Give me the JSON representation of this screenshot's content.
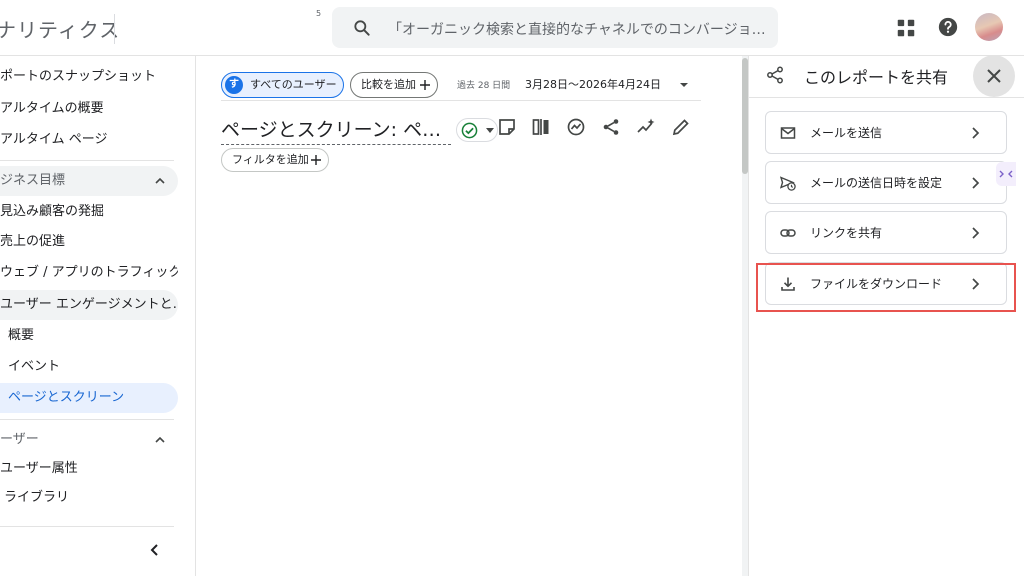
{
  "header": {
    "app_title": "ナリティクス",
    "tiny_mark": "5",
    "search_placeholder": "「オーガニック検索と直接的なチャネルでのコンバージョン…"
  },
  "sidebar": {
    "items": [
      {
        "label": "ポートのスナップショット",
        "kind": "item"
      },
      {
        "label": "アルタイムの概要",
        "kind": "item"
      },
      {
        "label": "アルタイム ページ",
        "kind": "item"
      },
      {
        "label": "ジネス目標",
        "kind": "section"
      },
      {
        "label": "見込み顧客の発掘",
        "kind": "item"
      },
      {
        "label": "売上の促進",
        "kind": "item"
      },
      {
        "label": "ウェブ / アプリのトラフィック…",
        "kind": "item"
      },
      {
        "label": "ユーザー エンゲージメントと…",
        "kind": "grouped"
      },
      {
        "label": "概要",
        "kind": "sub"
      },
      {
        "label": "イベント",
        "kind": "sub"
      },
      {
        "label": "ページとスクリーン",
        "kind": "selected"
      },
      {
        "label": "ーザー",
        "kind": "plain-section"
      },
      {
        "label": "ユーザー属性",
        "kind": "item"
      },
      {
        "label": "ライブラリ",
        "kind": "item"
      }
    ]
  },
  "toolbar": {
    "users_avatar_letter": "す",
    "users_chip": "すべてのユーザー",
    "compare_chip": "比較を追加",
    "period_label": "過去 28 日間",
    "date_range": "3月28日〜2026年4月24日",
    "page_heading": "ページとスクリーン: ページ タイトルとスクリーン クラス",
    "filter_chip": "フィルタを追加"
  },
  "share_panel": {
    "title": "このレポートを共有",
    "options": [
      {
        "label": "メールを送信",
        "icon": "mail-icon"
      },
      {
        "label": "メールの送信日時を設定",
        "icon": "schedule-send-icon"
      },
      {
        "label": "リンクを共有",
        "icon": "link-icon"
      },
      {
        "label": "ファイルをダウンロード",
        "icon": "download-icon"
      }
    ],
    "highlight_color": "#e8534f"
  },
  "colors": {
    "accent": "#1a73e8",
    "selected_bg": "#e8f0fe",
    "status_green": "#188038"
  }
}
